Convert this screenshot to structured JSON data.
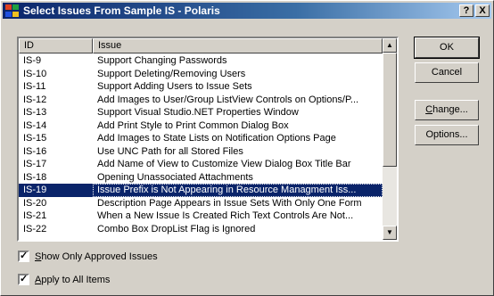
{
  "window": {
    "title": "Select Issues From Sample IS - Polaris",
    "help_label": "?",
    "close_label": "X"
  },
  "list": {
    "columns": [
      "ID",
      "Issue"
    ],
    "rows": [
      {
        "id": "IS-9",
        "issue": "Support Changing Passwords"
      },
      {
        "id": "IS-10",
        "issue": "Support Deleting/Removing Users"
      },
      {
        "id": "IS-11",
        "issue": "Support Adding Users to Issue Sets"
      },
      {
        "id": "IS-12",
        "issue": "Add Images to User/Group ListView Controls on Options/P..."
      },
      {
        "id": "IS-13",
        "issue": "Support Visual Studio.NET Properties Window"
      },
      {
        "id": "IS-14",
        "issue": "Add Print Style to Print Common Dialog Box"
      },
      {
        "id": "IS-15",
        "issue": "Add Images to State Lists on Notification Options Page"
      },
      {
        "id": "IS-16",
        "issue": "Use UNC Path for all Stored Files"
      },
      {
        "id": "IS-17",
        "issue": "Add Name of View to Customize View Dialog Box Title Bar"
      },
      {
        "id": "IS-18",
        "issue": "Opening Unassociated Attachments"
      },
      {
        "id": "IS-19",
        "issue": "Issue Prefix is Not Appearing in Resource Managment Iss..."
      },
      {
        "id": "IS-20",
        "issue": "Description Page Appears in Issue Sets With Only One Form"
      },
      {
        "id": "IS-21",
        "issue": "When a New Issue Is Created Rich Text Controls Are Not..."
      },
      {
        "id": "IS-22",
        "issue": "Combo Box DropList Flag is Ignored"
      }
    ],
    "selected_index": 10
  },
  "buttons": {
    "ok": "OK",
    "cancel": "Cancel",
    "change_accel": "C",
    "change_rest": "hange...",
    "options": "Options..."
  },
  "checkboxes": {
    "approved_accel": "S",
    "approved_rest": "how Only Approved Issues",
    "approved_checked": true,
    "apply_accel": "A",
    "apply_rest": "pply to All Items",
    "apply_checked": true
  },
  "icons": {
    "app": "polaris-app-icon",
    "scroll_up": "scroll-up-arrow-icon",
    "scroll_down": "scroll-down-arrow-icon",
    "check": "checkmark-icon"
  },
  "colors": {
    "title_start": "#0a246a",
    "title_end": "#a6caf0",
    "selection": "#0a246a",
    "face": "#d4d0c8"
  }
}
